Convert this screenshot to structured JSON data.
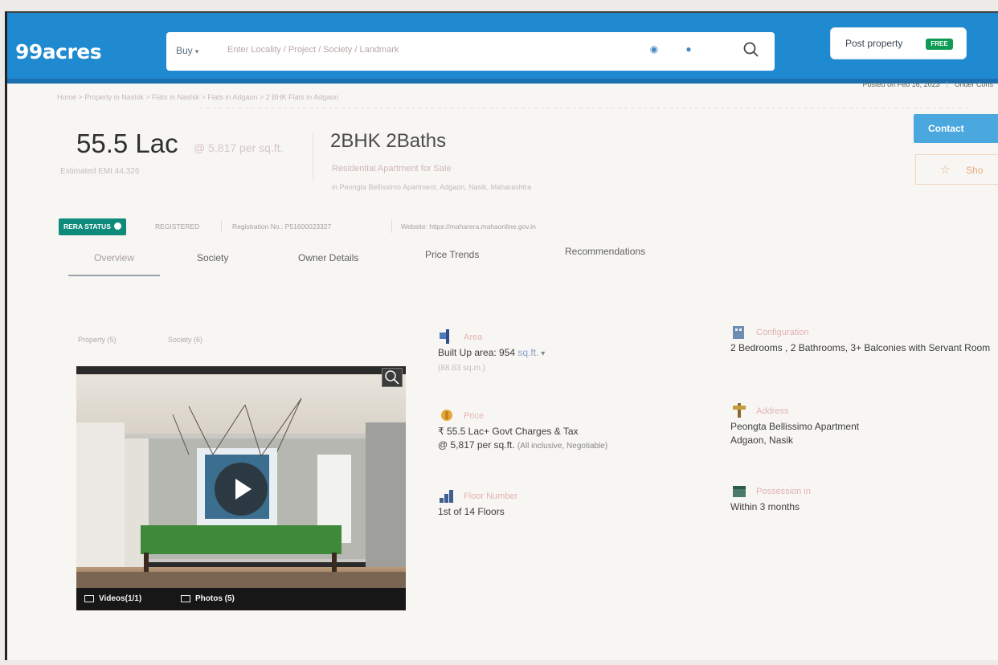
{
  "header": {
    "logo": "99acres",
    "search": {
      "buy_label": "Buy",
      "placeholder": "Enter Locality / Project / Society / Landmark"
    },
    "post_property": {
      "label": "Post property",
      "badge": "FREE"
    }
  },
  "listing_meta": {
    "posted": "Posted on Feb 16, 2023",
    "status": "Under Cons"
  },
  "breadcrumb": "Home > Property in Nashik > Flats in Nashik > Flats in Adgaon > 2 BHK Flats in Adgaon",
  "summary": {
    "price": "55.5 Lac",
    "price_per_sqft": "@ 5,817 per sq.ft.",
    "emi": "Estimated EMI 44,326",
    "config": "2BHK 2Baths",
    "type": "Residential Apartment for Sale",
    "address": "in Peongta Bellissimo Apartment, Adgaon, Nasik, Maharashtra"
  },
  "actions": {
    "contact": "Contact",
    "shortlist": "Sho"
  },
  "rera": {
    "badge": "RERA STATUS",
    "status": "REGISTERED",
    "registration": "Registration No.: P51600023327",
    "website": "Website: https://maharera.mahaonline.gov.in"
  },
  "tabs": [
    {
      "label": "Overview"
    },
    {
      "label": "Society"
    },
    {
      "label": "Owner Details"
    },
    {
      "label": "Price Trends"
    },
    {
      "label": "Recommendations"
    }
  ],
  "media": {
    "subtabs": [
      "Property (5)",
      "Society (6)"
    ],
    "videos": "Videos(1/1)",
    "photos": "Photos (5)"
  },
  "details": {
    "area": {
      "label": "Area",
      "value": "Built Up area: 954",
      "unit": "sq.ft.",
      "note": "(88.63 sq.m.)"
    },
    "config": {
      "label": "Configuration",
      "value": "2 Bedrooms , 2 Bathrooms, 3+ Balconies with Servant Room"
    },
    "price": {
      "label": "Price",
      "value": "₹ 55.5 Lac+ Govt Charges & Tax",
      "per": "@ 5,817 per sq.ft.",
      "note": "(All inclusive, Negotiable)"
    },
    "address": {
      "label": "Address",
      "value": "Peongta Bellissimo Apartment",
      "value2": "Adgaon, Nasik"
    },
    "floor": {
      "label": "Floor Number",
      "value": "1st  of 14 Floors"
    },
    "possession": {
      "label": "Possession in",
      "value": "Within 3 months"
    }
  },
  "colors": {
    "brand_blue": "#1f8ad0",
    "rera_green": "#0f8b7c",
    "free_green": "#0f9b55"
  }
}
